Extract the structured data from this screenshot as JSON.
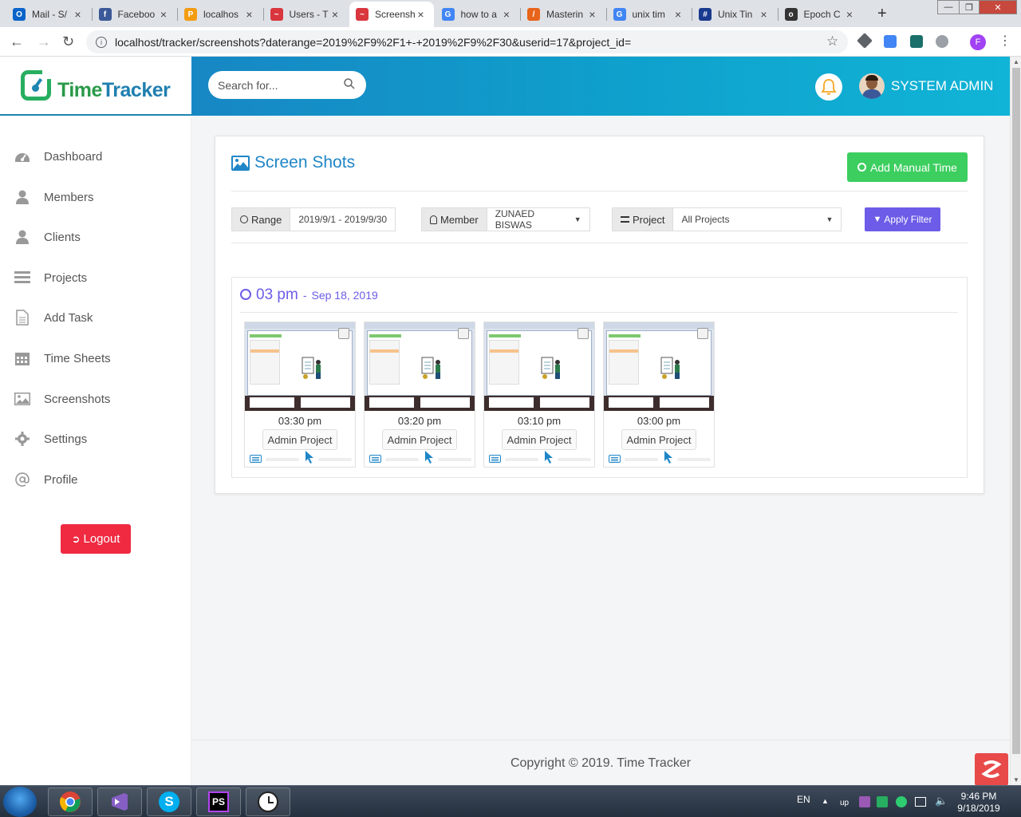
{
  "browser": {
    "tabs": [
      {
        "title": "Mail - S/",
        "color": "#0a64c9",
        "glyph": "O"
      },
      {
        "title": "Faceboo",
        "color": "#3b5998",
        "glyph": "f"
      },
      {
        "title": "localhos",
        "color": "#f39c12",
        "glyph": "P"
      },
      {
        "title": "Users - T",
        "color": "#d9363e",
        "glyph": "~"
      },
      {
        "title": "Screensh",
        "color": "#d9363e",
        "glyph": "~"
      },
      {
        "title": "how to a",
        "color": "#4285f4",
        "glyph": "G"
      },
      {
        "title": "Masterin",
        "color": "#e8641b",
        "glyph": "/"
      },
      {
        "title": "unix tim",
        "color": "#4285f4",
        "glyph": "G"
      },
      {
        "title": "Unix Tin",
        "color": "#1a3a8f",
        "glyph": "#"
      },
      {
        "title": "Epoch C",
        "color": "#333333",
        "glyph": "o"
      }
    ],
    "url": "localhost/tracker/screenshots?daterange=2019%2F9%2F1+-+2019%2F9%2F30&userid=17&project_id=",
    "profile_initial": "F"
  },
  "brand": {
    "name_part1": "Time",
    "name_part2": "Tracker"
  },
  "search": {
    "placeholder": "Search for..."
  },
  "user": {
    "name": "SYSTEM ADMIN"
  },
  "sidebar": {
    "items": [
      {
        "label": "Dashboard",
        "icon": "dashboard-icon"
      },
      {
        "label": "Members",
        "icon": "user-icon"
      },
      {
        "label": "Clients",
        "icon": "user-icon"
      },
      {
        "label": "Projects",
        "icon": "list-icon"
      },
      {
        "label": "Add Task",
        "icon": "document-icon"
      },
      {
        "label": "Time Sheets",
        "icon": "calendar-icon"
      },
      {
        "label": "Screenshots",
        "icon": "image-icon"
      },
      {
        "label": "Settings",
        "icon": "gear-icon"
      },
      {
        "label": "Profile",
        "icon": "at-icon"
      }
    ],
    "logout": "Logout"
  },
  "page": {
    "title": "Screen Shots",
    "add_manual_time": "Add Manual Time",
    "filters": {
      "range_label": "Range",
      "range_value": "2019/9/1 - 2019/9/30",
      "member_label": "Member",
      "member_value": "ZUNAED BISWAS",
      "project_label": "Project",
      "project_value": "All Projects",
      "apply": "Apply Filter"
    },
    "group": {
      "time": "03 pm",
      "separator": "-",
      "date": "Sep 18, 2019"
    },
    "screenshots": [
      {
        "time": "03:30 pm",
        "project": "Admin Project"
      },
      {
        "time": "03:20 pm",
        "project": "Admin Project"
      },
      {
        "time": "03:10 pm",
        "project": "Admin Project"
      },
      {
        "time": "03:00 pm",
        "project": "Admin Project"
      }
    ]
  },
  "footer": {
    "copyright": "Copyright © 2019. Time Tracker"
  },
  "taskbar": {
    "lang": "EN",
    "time": "9:46 PM",
    "date": "9/18/2019"
  },
  "colors": {
    "accent_blue": "#1f86c7",
    "green": "#3cce5f",
    "purple": "#6c5ce7",
    "logout_red": "#ef2a41"
  }
}
